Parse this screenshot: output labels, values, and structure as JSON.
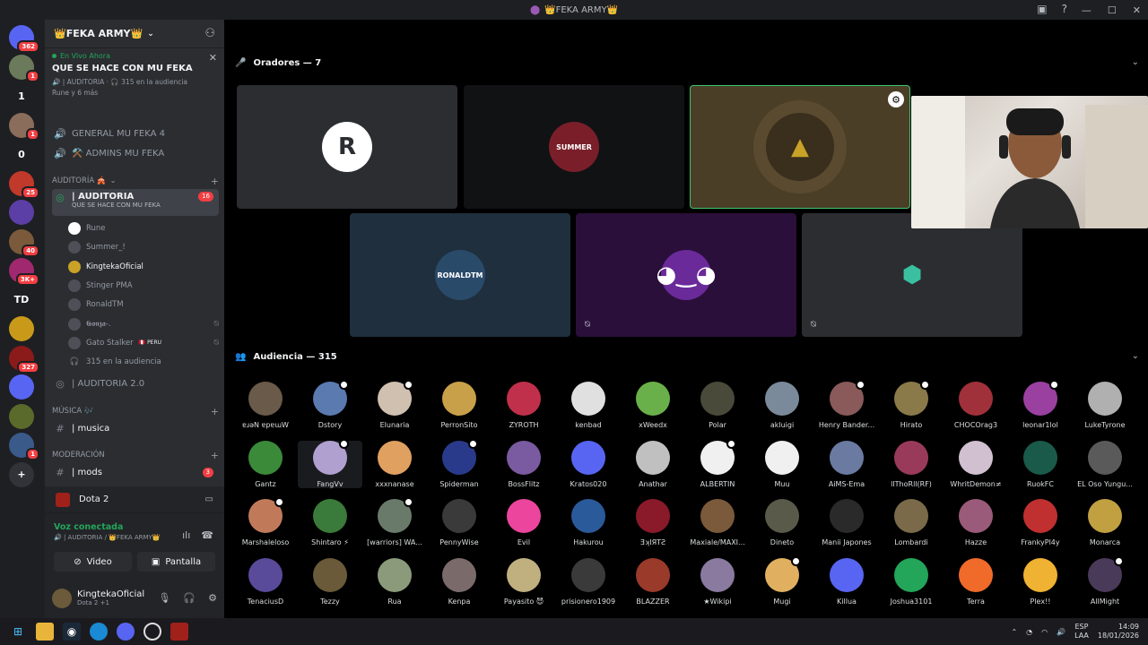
{
  "window": {
    "title": "👑FEKA ARMY👑"
  },
  "colors": {
    "accent": "#5865f2",
    "green": "#23a55a",
    "red": "#f23f43"
  },
  "servers": [
    {
      "label": "",
      "badge": "362",
      "color": "#5865f2"
    },
    {
      "label": "",
      "badge": "1",
      "color": "#6b7a5a"
    },
    {
      "label": "1",
      "badge": "",
      "color": "#1e1f22"
    },
    {
      "label": "",
      "badge": "1",
      "color": "#8a6d5a"
    },
    {
      "label": "0",
      "badge": "",
      "color": "#1e1f22"
    },
    {
      "label": "",
      "badge": "25",
      "color": "#c0392b"
    },
    {
      "label": "",
      "badge": "",
      "color": "#5b3fa6"
    },
    {
      "label": "",
      "badge": "40",
      "color": "#7a5a3a"
    },
    {
      "label": "",
      "badge": "3K+",
      "color": "#a0286e"
    },
    {
      "label": "TD",
      "badge": "",
      "color": "#1e1f22"
    },
    {
      "label": "",
      "badge": "",
      "color": "#c99a1a"
    },
    {
      "label": "",
      "badge": "327",
      "color": "#8b1a1a"
    },
    {
      "label": "",
      "badge": "",
      "color": "#5865f2"
    },
    {
      "label": "",
      "badge": "",
      "color": "#5a6a2a"
    },
    {
      "label": "",
      "badge": "1",
      "color": "#3a5a8a"
    },
    {
      "label": "+",
      "badge": "",
      "color": "#313338"
    }
  ],
  "sidebar": {
    "server_name": "👑FEKA ARMY👑",
    "live_label": "En Vivo Ahora",
    "stage_topic": "QUE SE HACE CON MU FEKA",
    "stage_meta": "🔊 | AUDITORIA · 🎧 315 en la audiencia",
    "stage_speakers": "Rune y 6 más",
    "channels_top": [
      {
        "label": "GENERAL MU FEKA 4",
        "icon": "🔊"
      },
      {
        "label": "⚒️ ADMINS MU FEKA",
        "icon": "🔊"
      }
    ],
    "cat_auditoria": "AUDITORÍA 🎪",
    "active_channel": "| AUDITORIA",
    "active_topic": "QUE SE HACE CON MU FEKA",
    "active_count": "16",
    "members": [
      {
        "name": "Rune",
        "color": "#ffffff",
        "muted": false
      },
      {
        "name": "Summer_!",
        "color": "#4e5058",
        "muted": false
      },
      {
        "name": "KingtekaOficial",
        "color": "#c9a227",
        "muted": false
      },
      {
        "name": "Stinger PMA",
        "color": "#4e5058",
        "muted": false
      },
      {
        "name": "RonaldTM",
        "color": "#4e5058",
        "muted": false
      },
      {
        "name": "𝕲𝖔𝖓𝖟𝖆-.",
        "color": "#4e5058",
        "muted": true
      },
      {
        "name": "Gato Stalker",
        "color": "#4e5058",
        "muted": true,
        "tag": "🇵🇪 PERU"
      }
    ],
    "audience_label": "315 en la audiencia",
    "auditoria2": "| AUDITORIA 2.0",
    "cat_musica": "MÚSICA 🎶",
    "musica": "| musica",
    "cat_moderacion": "MODERACIÓN",
    "mods": "| mods",
    "mods_badge": "3"
  },
  "activity": {
    "game": "Dota 2"
  },
  "voice": {
    "status": "Voz conectada",
    "sub": "🔊 | AUDITORIA / 👑FEKA ARMY👑",
    "video": "Video",
    "screen": "Pantalla"
  },
  "user": {
    "name": "KingtekaOficial",
    "status": "Dota 2 +1"
  },
  "stage": {
    "speakers_label": "Oradores — 7",
    "audience_label": "Audiencia — 315",
    "speakers": [
      {
        "name": "Rune",
        "bg": "#2b2d31",
        "logo": "R",
        "logo_bg": "#ffffff",
        "logo_fg": "#2b2d31"
      },
      {
        "name": "Summer_!",
        "bg": "#111214",
        "logo": "SUMMER",
        "logo_bg": "#7a1f2a",
        "logo_fg": "#ffffff"
      },
      {
        "name": "KingtekaOficial",
        "bg": "#4a3e26",
        "logo": "▲",
        "logo_bg": "#3a2f1c",
        "logo_fg": "#c9a227"
      },
      {
        "name": "RonaldTM",
        "bg": "#1f2f3d",
        "logo": "RONALDTM",
        "logo_bg": "#2a4a6a",
        "logo_fg": "#ffffff"
      },
      {
        "name": "Gonza",
        "bg": "#2a0f3a",
        "logo": "◕‿◕",
        "logo_bg": "#6a2a9a",
        "logo_fg": "#ffffff"
      },
      {
        "name": "Gato Stalker",
        "bg": "#2b2d31",
        "logo": "⬢",
        "logo_bg": "#2b2d31",
        "logo_fg": "#3ac0a0"
      }
    ]
  },
  "audience": [
    [
      "ɐɹǝN ɐpɐɯW",
      "Dstory",
      "Elunaria",
      "PerronSito",
      "ZYROTH",
      "kenbad",
      "xWeedx",
      "Polar",
      "akluigi",
      "Henry Bander...",
      "Hirato",
      "CHOCOrag3",
      "leonar1lol",
      "LukeTyrone"
    ],
    [
      "Gantz",
      "FangVv",
      "xxxnanase",
      "Spiderman",
      "BossFlitz",
      "Kratos020",
      "Anathar",
      "ALBERTIN",
      "Muu",
      "AiMS-Ema",
      "lIThoRll(RF)",
      "WhritDemon≠",
      "RuokFC",
      "EL Oso Yungu..."
    ],
    [
      "Marshaleloso",
      "Shintaro ⚡",
      "[warriors] WA...",
      "PennyWise",
      "Evil",
      "Hakurou",
      "ƎʞIЯTƧ",
      "Maxiale/MAXI...",
      "Dineto",
      "Manii Japones",
      "Lombardi",
      "Hazze",
      "FrankyPl4y",
      "Monarca"
    ],
    [
      "TenaciusD",
      "Tezzy",
      "Rua",
      "Kenpa",
      "Payasito 😈",
      "prisionero1909",
      "BLAZZER",
      "★Wikipi",
      "Mugi",
      "Killua",
      "Joshua3101",
      "Terra",
      "Plex!!",
      "AllMight"
    ]
  ],
  "audience_colors": [
    [
      "#6a5a4a",
      "#5a7ab0",
      "#d0c0b0",
      "#c9a04a",
      "#c0304a",
      "#e0e0e0",
      "#6ab04a",
      "#4a4a3a",
      "#7a8a9a",
      "#8a5a5a",
      "#8a7a4a",
      "#a0303a",
      "#9a40a0",
      "#b0b0b0"
    ],
    [
      "#3a8a3a",
      "#b0a0d0",
      "#e0a060",
      "#2a3a8a",
      "#7a5aa0",
      "#5865f2",
      "#c0c0c0",
      "#f0f0f0",
      "#f0f0f0",
      "#6a7aa0",
      "#9a3a5a",
      "#d0c0d0",
      "#1a5a4a",
      "#5a5a5a"
    ],
    [
      "#c07a5a",
      "#3a7a3a",
      "#6a7a6a",
      "#3a3a3a",
      "#eb459e",
      "#2a5a9a",
      "#8a1a2a",
      "#7a5a3a",
      "#5a5a4a",
      "#2a2a2a",
      "#7a6a4a",
      "#9a5a7a",
      "#c03030",
      "#c0a040"
    ],
    [
      "#5a4a9a",
      "#6a5a3a",
      "#8a9a7a",
      "#7a6a6a",
      "#c0b080",
      "#3a3a3a",
      "#9a3a2a",
      "#8a7aa0",
      "#e0b060",
      "#5865f2",
      "#23a55a",
      "#f06a2a",
      "#f0b232",
      "#4a3a5a"
    ]
  ],
  "audience_status": [
    [
      false,
      true,
      true,
      false,
      false,
      false,
      false,
      false,
      false,
      true,
      true,
      false,
      true,
      false
    ],
    [
      false,
      true,
      false,
      true,
      false,
      false,
      false,
      true,
      false,
      false,
      false,
      false,
      false,
      false
    ],
    [
      true,
      false,
      true,
      false,
      false,
      false,
      false,
      false,
      false,
      false,
      false,
      false,
      false,
      false
    ],
    [
      false,
      false,
      false,
      false,
      false,
      false,
      false,
      false,
      true,
      false,
      false,
      false,
      false,
      true
    ]
  ],
  "taskbar": {
    "lang": "ESP",
    "lang2": "LAA",
    "time": "14:09",
    "date": "18/01/2026"
  }
}
